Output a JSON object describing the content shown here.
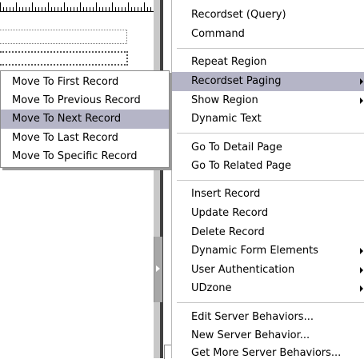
{
  "main_menu": {
    "items": [
      {
        "label": "Recordset (Query)"
      },
      {
        "label": "Command"
      },
      {
        "label": "Repeat Region"
      },
      {
        "label": "Recordset Paging"
      },
      {
        "label": "Show Region"
      },
      {
        "label": "Dynamic Text"
      },
      {
        "label": "Go To Detail Page"
      },
      {
        "label": "Go To Related Page"
      },
      {
        "label": "Insert Record"
      },
      {
        "label": "Update Record"
      },
      {
        "label": "Delete Record"
      },
      {
        "label": "Dynamic Form Elements"
      },
      {
        "label": "User Authentication"
      },
      {
        "label": "UDzone"
      },
      {
        "label": "Edit Server Behaviors..."
      },
      {
        "label": "New Server Behavior..."
      },
      {
        "label": "Get More Server Behaviors..."
      }
    ]
  },
  "submenu": {
    "items": [
      {
        "label": "Move To First Record"
      },
      {
        "label": "Move To Previous Record"
      },
      {
        "label": "Move To Next Record"
      },
      {
        "label": "Move To Last Record"
      },
      {
        "label": "Move To Specific Record"
      }
    ]
  },
  "colors": {
    "highlight": "#b5b5c7",
    "panel_separator": "#404040"
  },
  "icons": [
    "submenu-arrow-icon",
    "panel-collapse-arrow-icon"
  ]
}
